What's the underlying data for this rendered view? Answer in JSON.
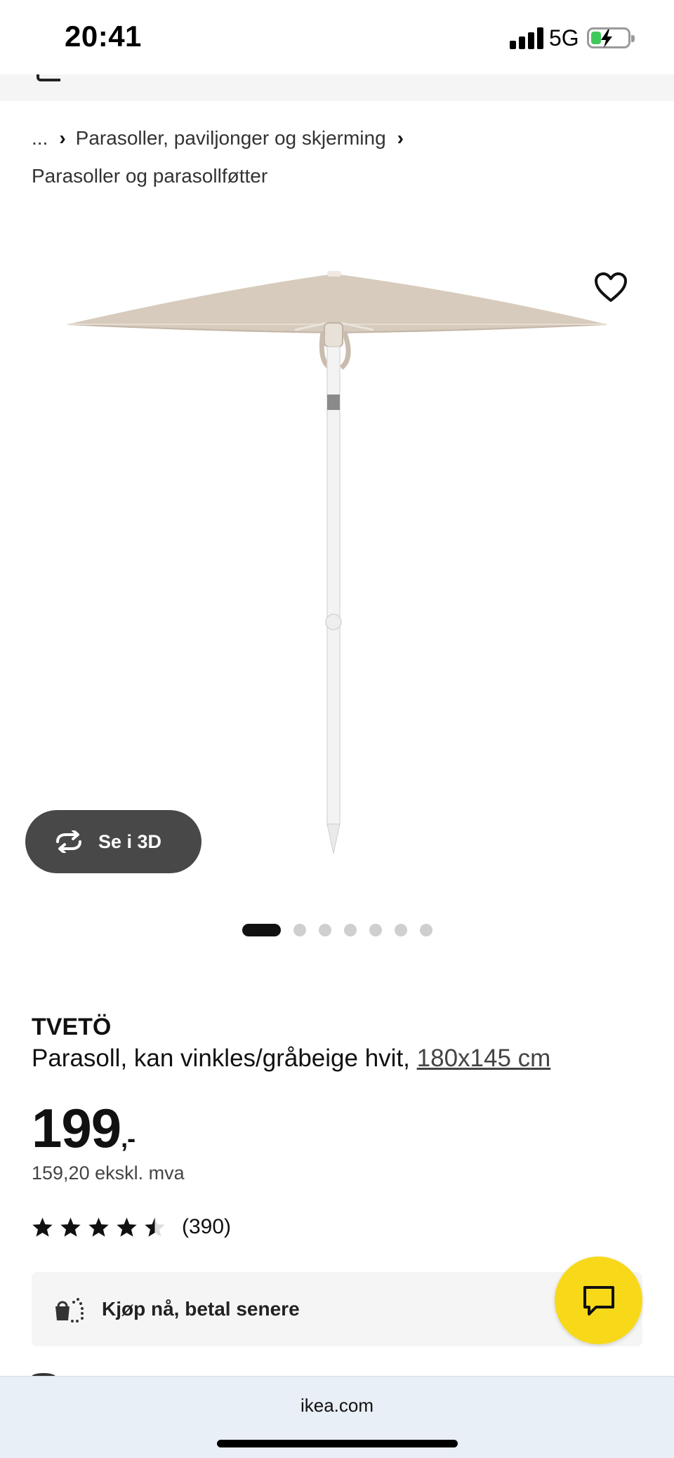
{
  "status_bar": {
    "time": "20:41",
    "network": "5G",
    "signal_icon": "signal-bars-icon",
    "battery_icon": "battery-charging-icon"
  },
  "breadcrumb": {
    "ellipsis": "...",
    "level1": "Parasoller, paviljonger og skjerming",
    "level2": "Parasoller og parasollføtter",
    "separator_icon": "chevron-right-icon"
  },
  "gallery": {
    "image_icon": "parasol-product-image",
    "favorite_icon": "heart-icon",
    "view_3d_label": "Se i 3D",
    "view_3d_icon": "rotate-arrows-icon",
    "image_count": 7,
    "active_index": 0
  },
  "product": {
    "name": "TVETÖ",
    "description": "Parasoll, kan vinkles/gråbeige hvit,",
    "size_link": "180x145 cm",
    "price_main": "199",
    "price_suffix": ",-",
    "price_ex_vat": "159,20 ekskl. mva",
    "rating_value": 4.5,
    "rating_max": 5,
    "review_count": "(390)"
  },
  "payment": {
    "label": "Kjøp nå, betal senere",
    "icon": "shopping-bag-installment-icon"
  },
  "chat": {
    "icon": "chat-bubble-icon",
    "color": "#f8d91a"
  },
  "browser": {
    "url": "ikea.com"
  }
}
